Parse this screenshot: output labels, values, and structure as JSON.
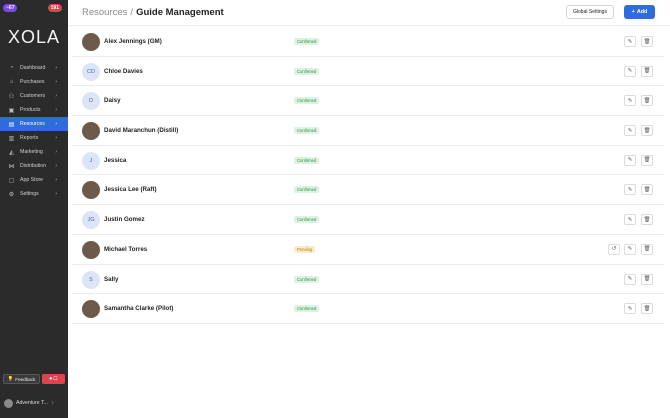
{
  "sidebar": {
    "badge_left": "~67",
    "badge_right": "191",
    "logo": "XOLA",
    "items": [
      {
        "label": "Dashboard",
        "icon": "dashboard-icon",
        "glyph": "◔",
        "active": false
      },
      {
        "label": "Purchases",
        "icon": "purchases-icon",
        "glyph": "⌂",
        "active": false
      },
      {
        "label": "Customers",
        "icon": "customers-icon",
        "glyph": "⚇",
        "active": false
      },
      {
        "label": "Products",
        "icon": "products-icon",
        "glyph": "▣",
        "active": false
      },
      {
        "label": "Resources",
        "icon": "resources-icon",
        "glyph": "▤",
        "active": true
      },
      {
        "label": "Reports",
        "icon": "reports-icon",
        "glyph": "▥",
        "active": false
      },
      {
        "label": "Marketing",
        "icon": "marketing-icon",
        "glyph": "◭",
        "active": false
      },
      {
        "label": "Distribution",
        "icon": "distribution-icon",
        "glyph": "⋈",
        "active": false
      },
      {
        "label": "App Store",
        "icon": "app-store-icon",
        "glyph": "▢",
        "active": false
      },
      {
        "label": "Settings",
        "icon": "settings-icon",
        "glyph": "⚙",
        "active": false
      }
    ],
    "feedback_label": "Feedback",
    "record_label": "⏺ ▢",
    "account_label": "Adventure T..."
  },
  "header": {
    "crumb_parent": "Resources",
    "separator": "/",
    "title": "Guide Management",
    "global_settings_label": "Global Settings",
    "add_label": "Add",
    "add_icon": "+"
  },
  "guides": [
    {
      "name": "Alex Jennings (GM)",
      "initials": "",
      "photo": true,
      "status": "Confirmed",
      "extra_action": false
    },
    {
      "name": "Chloe Davies",
      "initials": "CD",
      "photo": false,
      "status": "Confirmed",
      "extra_action": false
    },
    {
      "name": "Daisy",
      "initials": "D",
      "photo": false,
      "status": "Confirmed",
      "extra_action": false
    },
    {
      "name": "David Maranchun (Distill)",
      "initials": "",
      "photo": true,
      "status": "Confirmed",
      "extra_action": false
    },
    {
      "name": "Jessica",
      "initials": "J",
      "photo": false,
      "status": "Confirmed",
      "extra_action": false
    },
    {
      "name": "Jessica Lee (Raft)",
      "initials": "",
      "photo": true,
      "status": "Confirmed",
      "extra_action": false
    },
    {
      "name": "Justin Gomez",
      "initials": "JG",
      "photo": false,
      "status": "Confirmed",
      "extra_action": false
    },
    {
      "name": "Michael Torres",
      "initials": "",
      "photo": true,
      "status": "Pending",
      "extra_action": true
    },
    {
      "name": "Sally",
      "initials": "S",
      "photo": false,
      "status": "Confirmed",
      "extra_action": false
    },
    {
      "name": "Samantha Clarke (Pilot)",
      "initials": "",
      "photo": true,
      "status": "Confirmed",
      "extra_action": false
    }
  ],
  "icons": {
    "edit": "✎",
    "delete": "🗑",
    "resend": "↺",
    "chevron": "›",
    "feedback": "💡"
  },
  "colors": {
    "accent": "#2f6bdc",
    "sidebar_bg": "#2b2b2b",
    "confirmed_bg": "#dcf3e2",
    "pending_bg": "#fbecc9"
  }
}
